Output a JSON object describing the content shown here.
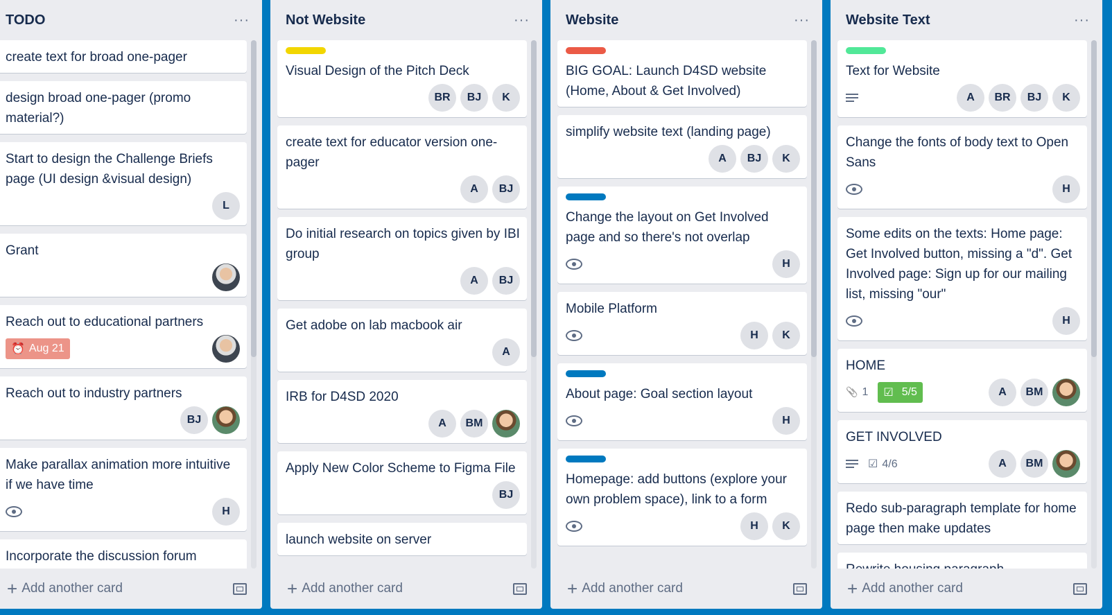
{
  "colors": {
    "board_bg": "#0079bf",
    "list_bg": "#ebecf0",
    "label_yellow": "#f2d600",
    "label_red": "#eb5a46",
    "label_blue": "#0079bf",
    "label_green": "#51e898",
    "due_bg": "#ec9488",
    "checklist_done_bg": "#61bd4f"
  },
  "lists": [
    {
      "title": "TODO",
      "menu": "···",
      "add_label": "Add another card",
      "cards": [
        {
          "title": "create text for broad one-pager",
          "members": []
        },
        {
          "title": "design broad one-pager (promo material?)",
          "members": []
        },
        {
          "title": "Start to design the Challenge Briefs page (UI design &visual design)",
          "members": [
            "L"
          ]
        },
        {
          "title": "Grant",
          "members": [
            "photo-gray"
          ]
        },
        {
          "title": "Reach out to educational partners",
          "due": "Aug 21",
          "members": [
            "photo-gray"
          ]
        },
        {
          "title": "Reach out to industry partners",
          "members": [
            "BJ",
            "photo"
          ]
        },
        {
          "title": "Make parallax animation more intuitive if we have time",
          "watch": true,
          "members": [
            "H"
          ]
        },
        {
          "title": "Incorporate the discussion forum",
          "members": []
        }
      ]
    },
    {
      "title": "Not Website",
      "menu": "···",
      "add_label": "Add another card",
      "cards": [
        {
          "label": "label_yellow",
          "title": "Visual Design of the Pitch Deck",
          "members": [
            "BR",
            "BJ",
            "K"
          ]
        },
        {
          "title": "create text for educator version one-pager",
          "members": [
            "A",
            "BJ"
          ]
        },
        {
          "title": "Do initial research on topics given by IBI group",
          "members": [
            "A",
            "BJ"
          ]
        },
        {
          "title": "Get adobe on lab macbook air",
          "members": [
            "A"
          ]
        },
        {
          "title": "IRB for D4SD 2020",
          "members": [
            "A",
            "BM",
            "photo"
          ]
        },
        {
          "title": "Apply New Color Scheme to Figma File",
          "members": [
            "BJ"
          ]
        },
        {
          "title": "launch website on server",
          "members": []
        }
      ]
    },
    {
      "title": "Website",
      "menu": "···",
      "add_label": "Add another card",
      "cards": [
        {
          "label": "label_red",
          "title": "BIG GOAL: Launch D4SD website (Home, About & Get Involved)",
          "members": []
        },
        {
          "title": "simplify website text (landing page)",
          "members": [
            "A",
            "BJ",
            "K"
          ]
        },
        {
          "label": "label_blue",
          "title": "Change the layout on Get Involved page and so there's not overlap",
          "watch": true,
          "members": [
            "H"
          ]
        },
        {
          "title": "Mobile Platform",
          "watch": true,
          "members": [
            "H",
            "K"
          ]
        },
        {
          "label": "label_blue",
          "title": "About page: Goal section layout",
          "watch": true,
          "members": [
            "H"
          ]
        },
        {
          "label": "label_blue",
          "title": "Homepage: add buttons (explore your own problem space), link to a form",
          "watch": true,
          "members": [
            "H",
            "K"
          ]
        }
      ]
    },
    {
      "title": "Website Text",
      "menu": "···",
      "add_label": "Add another card",
      "cards": [
        {
          "label": "label_green",
          "title": "Text for Website",
          "desc": true,
          "members": [
            "A",
            "BR",
            "BJ",
            "K"
          ]
        },
        {
          "title": "Change the fonts of body text to Open Sans",
          "watch": true,
          "members": [
            "H"
          ]
        },
        {
          "title": "Some edits on the texts: Home page: Get Involved button, missing a \"d\". Get Involved page: Sign up for our mailing list, missing \"our\"",
          "watch": true,
          "members": [
            "H"
          ]
        },
        {
          "title": "HOME",
          "attachments": "1",
          "checklist": "5/5",
          "checklist_done": true,
          "members": [
            "A",
            "BM",
            "photo"
          ]
        },
        {
          "title": "GET INVOLVED",
          "desc": true,
          "checklist": "4/6",
          "members": [
            "A",
            "BM",
            "photo"
          ]
        },
        {
          "title": "Redo sub-paragraph template for home page then make updates",
          "members": []
        },
        {
          "title": "Rewrite housing paragraph",
          "members": []
        }
      ]
    }
  ]
}
